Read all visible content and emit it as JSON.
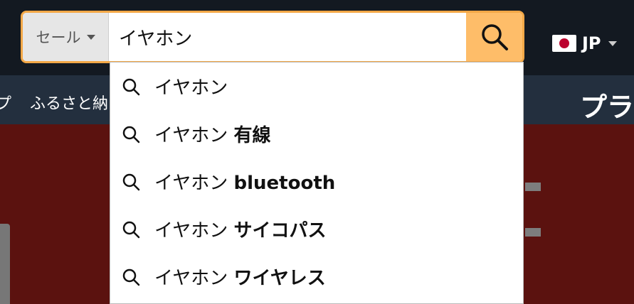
{
  "header": {
    "department": "セール",
    "search_value": "イヤホン",
    "locale": "JP"
  },
  "subnav": {
    "left_clipped": "プ",
    "item": "ふるさと納",
    "promo": "プラ"
  },
  "suggestions": [
    {
      "prefix": "イヤホン",
      "suffix": ""
    },
    {
      "prefix": "イヤホン",
      "suffix": "有線"
    },
    {
      "prefix": "イヤホン",
      "suffix": "bluetooth"
    },
    {
      "prefix": "イヤホン",
      "suffix": "サイコパス"
    },
    {
      "prefix": "イヤホン",
      "suffix": "ワイヤレス"
    }
  ],
  "icons": {
    "search": "search-icon",
    "suggestion": "search-icon",
    "flag": "japan-flag-icon",
    "dropdown": "chevron-down-icon"
  },
  "colors": {
    "header_bg": "#131921",
    "subnav_bg": "#232f3e",
    "search_accent": "#f3a847",
    "search_button": "#febd69",
    "hero_bg": "#5b120f"
  }
}
